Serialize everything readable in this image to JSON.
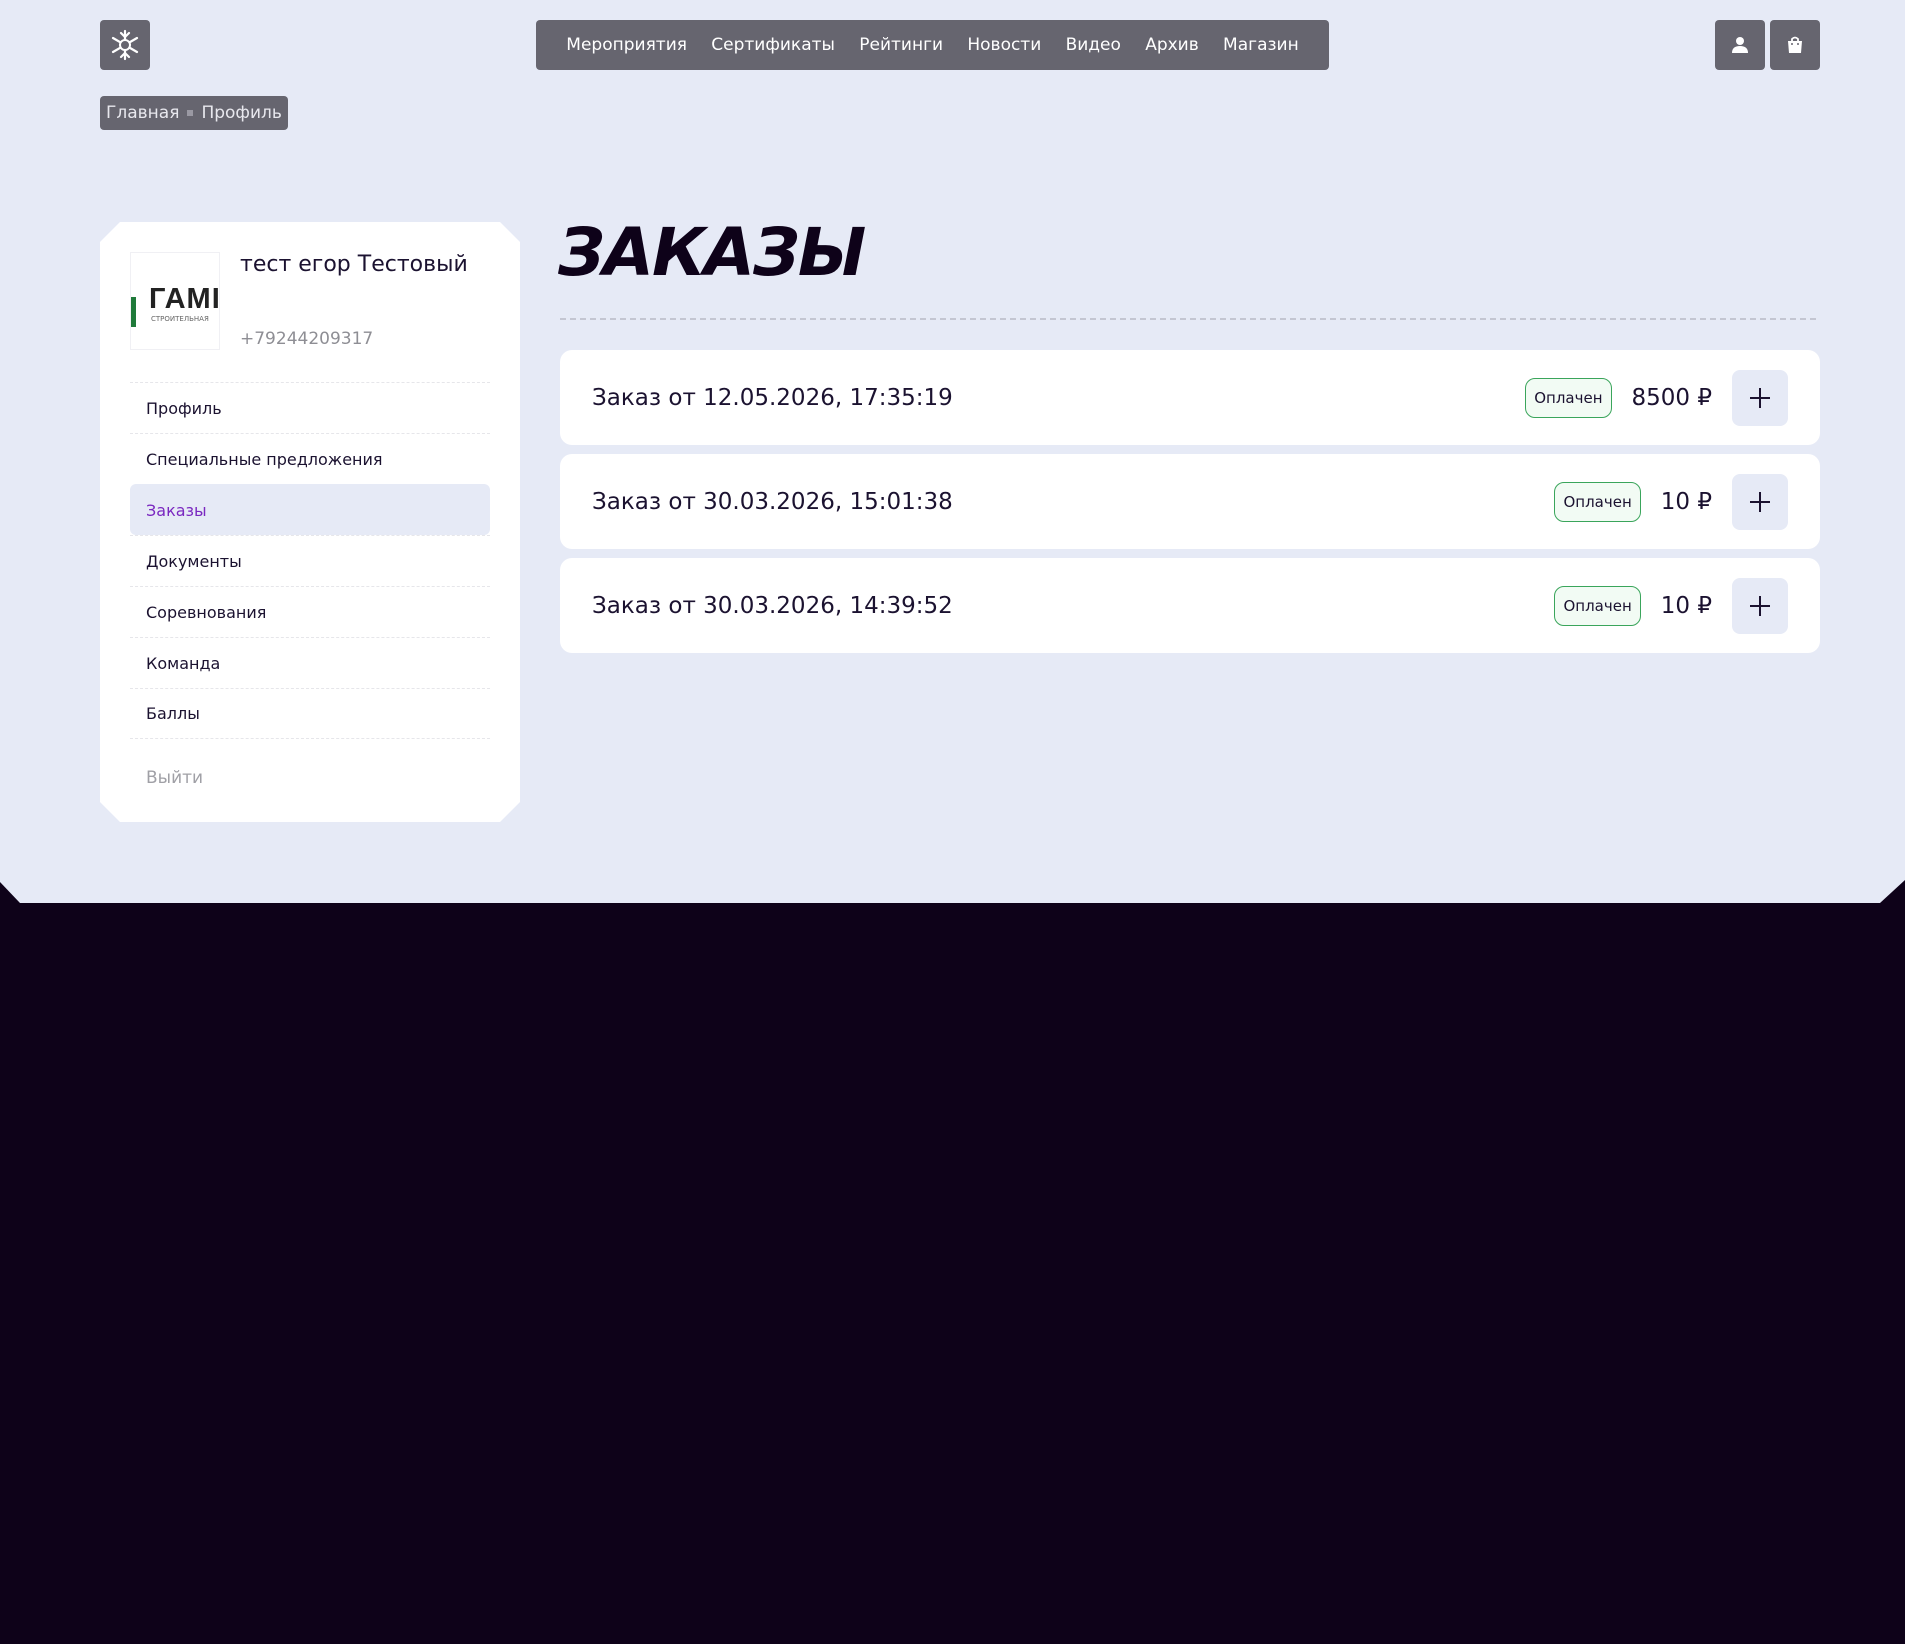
{
  "header": {
    "logo_icon": "snowflake-star-logo-icon",
    "nav": [
      "Мероприятия",
      "Сертификаты",
      "Рейтинги",
      "Новости",
      "Видео",
      "Архив",
      "Магазин"
    ],
    "profile_icon": "user-icon",
    "cart_icon": "shopping-bag-icon"
  },
  "breadcrumb": {
    "home": "Главная",
    "current": "Профиль"
  },
  "sidebar": {
    "avatar_text": "ГАМІ",
    "avatar_subtext": "СТРОИТЕЛЬНАЯ",
    "user_name": "тест егор Тестовый",
    "phone": "+79244209317",
    "menu": [
      {
        "label": "Профиль"
      },
      {
        "label": "Специальные предложения"
      },
      {
        "label": "Заказы",
        "active": true
      },
      {
        "label": "Документы"
      },
      {
        "label": "Соревнования"
      },
      {
        "label": "Команда"
      },
      {
        "label": "Баллы"
      }
    ],
    "logout": "Выйти"
  },
  "main": {
    "title": "ЗАКАЗЫ",
    "orders": [
      {
        "title": "Заказ от 12.05.2026, 17:35:19",
        "status": "Оплачен",
        "price": "8500 ₽"
      },
      {
        "title": "Заказ от 30.03.2026, 15:01:38",
        "status": "Оплачен",
        "price": "10 ₽"
      },
      {
        "title": "Заказ от 30.03.2026, 14:39:52",
        "status": "Оплачен",
        "price": "10 ₽"
      }
    ]
  },
  "colors": {
    "page_bg": "#e6eaf6",
    "footer_bg": "#0e0219",
    "nav_bg": "#66656f",
    "accent_active": "#7a28c0",
    "status_border": "#3aa55b"
  }
}
